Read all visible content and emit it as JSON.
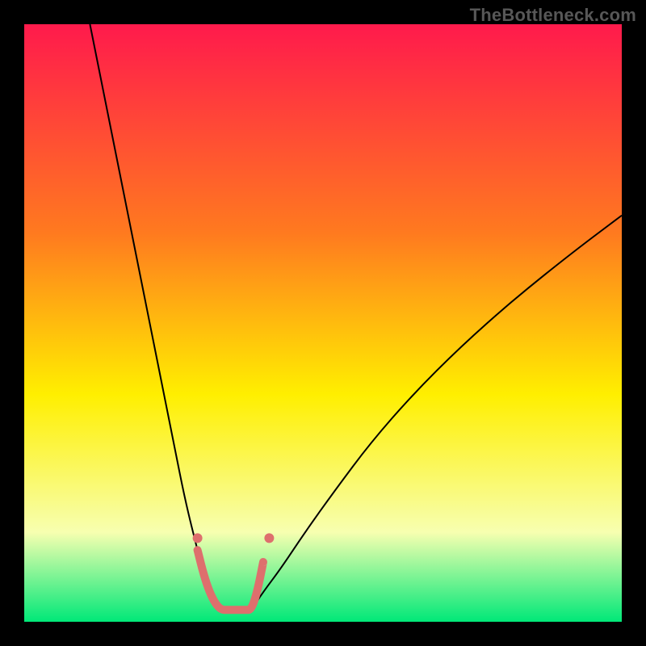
{
  "watermark": "TheBottleneck.com",
  "chart_data": {
    "type": "line",
    "title": "",
    "xlabel": "",
    "ylabel": "",
    "xlim": [
      0,
      100
    ],
    "ylim": [
      0,
      100
    ],
    "grid": false,
    "legend": false,
    "background_gradient": {
      "top_color": "#ff1a4c",
      "mid_color": "#ffef00",
      "bottom_color": "#00e878",
      "direction": "vertical"
    },
    "series": [
      {
        "name": "left-curve",
        "color": "#000000",
        "width": 2,
        "x": [
          11,
          13,
          15,
          17,
          19,
          21,
          23,
          25,
          27,
          29,
          30,
          31,
          32,
          33
        ],
        "y": [
          100,
          90,
          80,
          70,
          60,
          50,
          40,
          30,
          20,
          12,
          8,
          5,
          3,
          2
        ]
      },
      {
        "name": "right-curve",
        "color": "#000000",
        "width": 2,
        "x": [
          38,
          40,
          43,
          47,
          52,
          58,
          65,
          73,
          82,
          92,
          100
        ],
        "y": [
          2,
          5,
          9,
          15,
          22,
          30,
          38,
          46,
          54,
          62,
          68
        ]
      },
      {
        "name": "bottom-band",
        "color": "#de6f6d",
        "width": 10,
        "linecap": "round",
        "x": [
          29,
          30,
          31,
          32,
          33,
          34,
          35,
          36,
          37,
          38,
          39,
          40
        ],
        "y": [
          12,
          8,
          5,
          3,
          2,
          2,
          2,
          2,
          2,
          2,
          5,
          10
        ]
      }
    ],
    "points": [
      {
        "name": "marker-left",
        "x": 29,
        "y": 14,
        "r": 6,
        "color": "#de6f6d"
      },
      {
        "name": "marker-right",
        "x": 41,
        "y": 14,
        "r": 6,
        "color": "#de6f6d"
      }
    ]
  }
}
